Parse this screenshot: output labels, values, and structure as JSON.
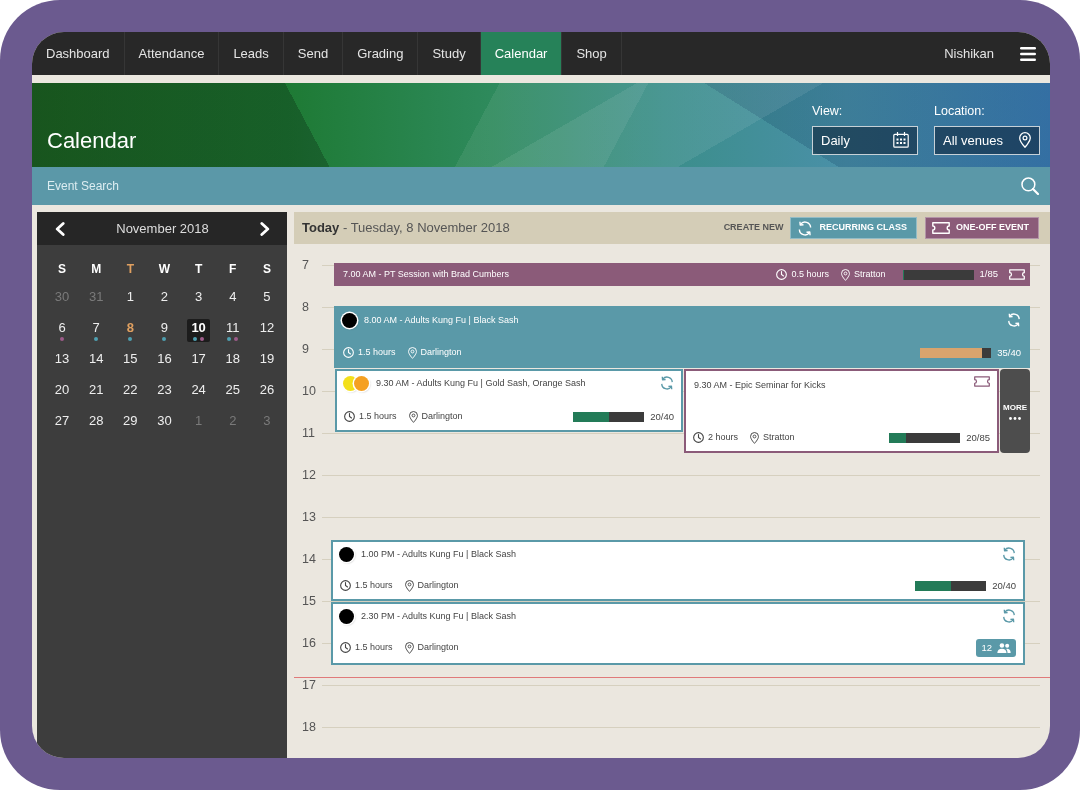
{
  "nav": {
    "tabs": [
      {
        "label": "Dashboard",
        "selected": false
      },
      {
        "label": "Attendance",
        "selected": false
      },
      {
        "label": "Leads",
        "selected": false
      },
      {
        "label": "Send",
        "selected": false
      },
      {
        "label": "Grading",
        "selected": false
      },
      {
        "label": "Study",
        "selected": false
      },
      {
        "label": "Calendar",
        "selected": true
      },
      {
        "label": "Shop",
        "selected": false
      }
    ],
    "user": "Nishikan"
  },
  "header": {
    "title": "Calendar",
    "view": {
      "label": "View:",
      "value": "Daily"
    },
    "location": {
      "label": "Location:",
      "value": "All venues"
    }
  },
  "search": {
    "placeholder": "Event Search"
  },
  "mini_calendar": {
    "month": "November 2018",
    "weekdays": [
      {
        "label": "S",
        "today": false
      },
      {
        "label": "M",
        "today": false
      },
      {
        "label": "T",
        "today": true
      },
      {
        "label": "W",
        "today": false
      },
      {
        "label": "T",
        "today": false
      },
      {
        "label": "F",
        "today": false
      },
      {
        "label": "S",
        "today": false
      }
    ],
    "days": [
      {
        "label": "30",
        "muted": true,
        "today": false,
        "selected": false
      },
      {
        "label": "31",
        "muted": true,
        "today": false,
        "selected": false
      },
      {
        "label": "1",
        "muted": false,
        "today": false,
        "selected": false
      },
      {
        "label": "2",
        "muted": false,
        "today": false,
        "selected": false
      },
      {
        "label": "3",
        "muted": false,
        "today": false,
        "selected": false
      },
      {
        "label": "4",
        "muted": false,
        "today": false,
        "selected": false
      },
      {
        "label": "5",
        "muted": false,
        "today": false,
        "selected": false
      },
      {
        "label": "6",
        "muted": false,
        "today": false,
        "selected": false,
        "dots": [
          {
            "color": "#9c5b8a"
          }
        ]
      },
      {
        "label": "7",
        "muted": false,
        "today": false,
        "selected": false,
        "dots": [
          {
            "color": "#4e9fb0"
          }
        ]
      },
      {
        "label": "8",
        "muted": false,
        "today": true,
        "selected": false,
        "dots": [
          {
            "color": "#4e9fb0"
          }
        ]
      },
      {
        "label": "9",
        "muted": false,
        "today": false,
        "selected": false,
        "dots": [
          {
            "color": "#4e9fb0"
          }
        ]
      },
      {
        "label": "10",
        "muted": false,
        "today": false,
        "selected": true,
        "dots": [
          {
            "color": "#4e9fb0"
          },
          {
            "color": "#9c5b8a"
          }
        ]
      },
      {
        "label": "11",
        "muted": false,
        "today": false,
        "selected": false,
        "dots": [
          {
            "color": "#4e9fb0"
          },
          {
            "color": "#9c5b8a"
          }
        ]
      },
      {
        "label": "12",
        "muted": false,
        "today": false,
        "selected": false
      },
      {
        "label": "13",
        "muted": false,
        "today": false,
        "selected": false
      },
      {
        "label": "14",
        "muted": false,
        "today": false,
        "selected": false
      },
      {
        "label": "15",
        "muted": false,
        "today": false,
        "selected": false
      },
      {
        "label": "16",
        "muted": false,
        "today": false,
        "selected": false
      },
      {
        "label": "17",
        "muted": false,
        "today": false,
        "selected": false
      },
      {
        "label": "18",
        "muted": false,
        "today": false,
        "selected": false
      },
      {
        "label": "19",
        "muted": false,
        "today": false,
        "selected": false
      },
      {
        "label": "20",
        "muted": false,
        "today": false,
        "selected": false
      },
      {
        "label": "21",
        "muted": false,
        "today": false,
        "selected": false
      },
      {
        "label": "22",
        "muted": false,
        "today": false,
        "selected": false
      },
      {
        "label": "23",
        "muted": false,
        "today": false,
        "selected": false
      },
      {
        "label": "24",
        "muted": false,
        "today": false,
        "selected": false
      },
      {
        "label": "25",
        "muted": false,
        "today": false,
        "selected": false
      },
      {
        "label": "26",
        "muted": false,
        "today": false,
        "selected": false
      },
      {
        "label": "27",
        "muted": false,
        "today": false,
        "selected": false
      },
      {
        "label": "28",
        "muted": false,
        "today": false,
        "selected": false
      },
      {
        "label": "29",
        "muted": false,
        "today": false,
        "selected": false
      },
      {
        "label": "30",
        "muted": false,
        "today": false,
        "selected": false
      },
      {
        "label": "1",
        "muted": true,
        "today": false,
        "selected": false
      },
      {
        "label": "2",
        "muted": true,
        "today": false,
        "selected": false
      },
      {
        "label": "3",
        "muted": true,
        "today": false,
        "selected": false
      }
    ]
  },
  "day_view": {
    "heading": "**Today** - Tuesday, 8 November 2018",
    "create_label": "CREATE NEW",
    "create_buttons": [
      {
        "label": "RECURRING CLASS",
        "kind": "recurring"
      },
      {
        "label": "ONE-OFF EVENT",
        "kind": "one_off"
      }
    ],
    "hours": [
      "7",
      "8",
      "9",
      "10",
      "11",
      "12",
      "13",
      "14",
      "15",
      "16",
      "17",
      "18"
    ],
    "events": [
      {
        "kind": "one_off",
        "highlighted": true,
        "title": "7.00 AM - PT Session with Brad Cumbers",
        "duration": "0.5 hours",
        "location": "Stratton",
        "capacity": {
          "level": 0.012,
          "reading": "1/85"
        }
      },
      {
        "kind": "recurring",
        "highlighted": true,
        "sashes": [
          {
            "color": "#000000"
          }
        ],
        "title": "8.00 AM - Adults Kung Fu | Black Sash",
        "duration": "1.5 hours",
        "location": "Darlington",
        "capacity": {
          "level": 0.875,
          "reading": "35/40"
        }
      },
      {
        "kind": "recurring",
        "highlighted": false,
        "sashes": [
          {
            "color": "#f3e01b"
          },
          {
            "color": "#f5a021"
          }
        ],
        "title": "9.30 AM - Adults Kung Fu | Gold Sash, Orange Sash",
        "duration": "1.5 hours",
        "location": "Darlington",
        "capacity": {
          "level": 0.5,
          "reading": "20/40"
        }
      },
      {
        "kind": "one_off",
        "highlighted": false,
        "title": "9.30 AM - Epic Seminar for Kicks",
        "duration": "2 hours",
        "location": "Stratton",
        "capacity": {
          "level": 0.235,
          "reading": "20/85"
        }
      },
      {
        "kind": "recurring",
        "highlighted": false,
        "sashes": [
          {
            "color": "#000000"
          }
        ],
        "title": "1.00 PM - Adults Kung Fu | Black Sash",
        "duration": "1.5 hours",
        "location": "Darlington",
        "capacity": {
          "level": 0.5,
          "reading": "20/40"
        }
      },
      {
        "kind": "recurring",
        "highlighted": false,
        "sashes": [
          {
            "color": "#000000"
          }
        ],
        "title": "2.30 PM - Adults Kung Fu | Black Sash",
        "duration": "1.5 hours",
        "location": "Darlington",
        "attendees": "12"
      }
    ],
    "more_label": "MORE"
  }
}
